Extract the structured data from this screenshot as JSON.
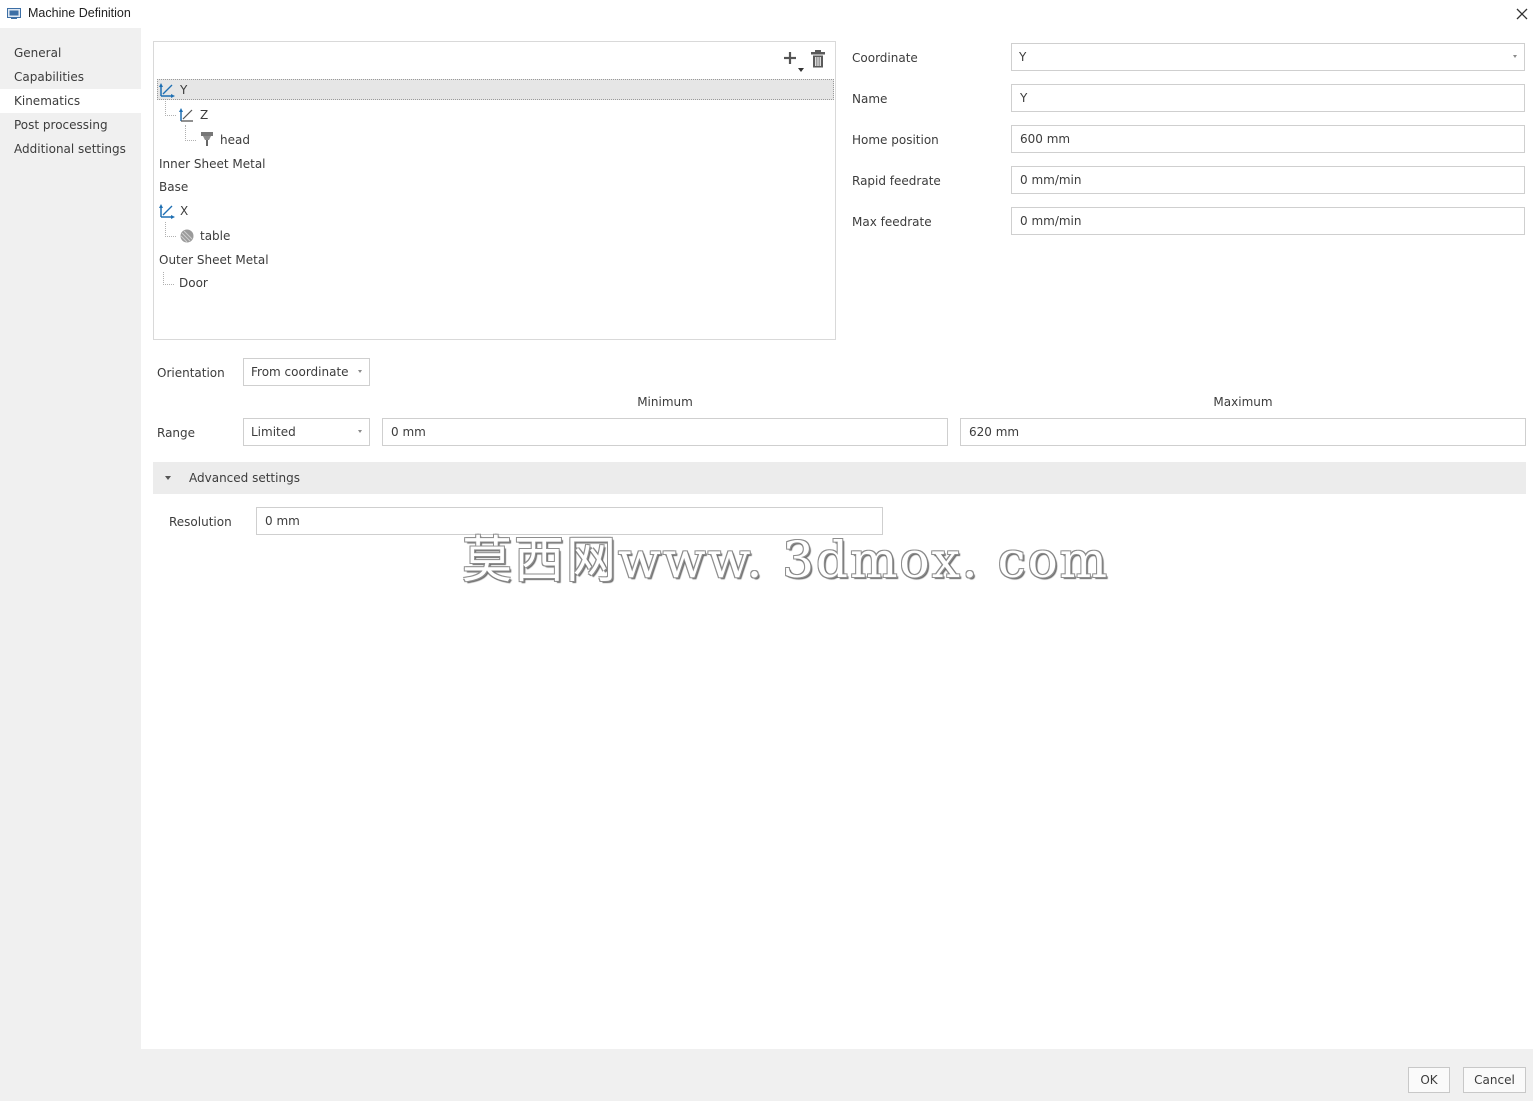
{
  "window": {
    "title": "Machine Definition",
    "icon": "machine-icon",
    "close_icon": "close-icon"
  },
  "sidebar": {
    "items": [
      {
        "label": "General",
        "active": false
      },
      {
        "label": "Capabilities",
        "active": false
      },
      {
        "label": "Kinematics",
        "active": true
      },
      {
        "label": "Post processing",
        "active": false
      },
      {
        "label": "Additional settings",
        "active": false
      }
    ]
  },
  "tree": {
    "toolbar": {
      "add_icon": "plus-icon",
      "delete_icon": "trash-icon"
    },
    "items": [
      {
        "label": "Y",
        "icon": "axis-linear-icon",
        "selected": true
      },
      {
        "label": "Z",
        "icon": "axis-linear-icon"
      },
      {
        "label": "head",
        "icon": "spindle-head-icon"
      },
      {
        "label": "Inner Sheet Metal"
      },
      {
        "label": "Base"
      },
      {
        "label": "X",
        "icon": "axis-linear-icon"
      },
      {
        "label": "table",
        "icon": "table-icon"
      },
      {
        "label": "Outer Sheet Metal"
      },
      {
        "label": "Door"
      }
    ]
  },
  "properties": {
    "coordinate": {
      "label": "Coordinate",
      "value": "Y"
    },
    "name": {
      "label": "Name",
      "value": "Y"
    },
    "home_position": {
      "label": "Home position",
      "value": "600 mm"
    },
    "rapid_feedrate": {
      "label": "Rapid feedrate",
      "value": "0 mm/min"
    },
    "max_feedrate": {
      "label": "Max feedrate",
      "value": "0 mm/min"
    }
  },
  "orientation": {
    "label": "Orientation",
    "value": "From coordinate"
  },
  "range": {
    "label": "Range",
    "mode": "Limited",
    "min_header": "Minimum",
    "max_header": "Maximum",
    "min": "0 mm",
    "max": "620 mm"
  },
  "advanced": {
    "label": "Advanced settings",
    "expanded": true,
    "resolution_label": "Resolution",
    "resolution": "0 mm"
  },
  "watermark": "莫西网www. 3dmox. com",
  "buttons": {
    "ok": "OK",
    "cancel": "Cancel"
  },
  "colors": {
    "accent_icon": "#1f6fb2",
    "selection": "#e6e6e6"
  }
}
